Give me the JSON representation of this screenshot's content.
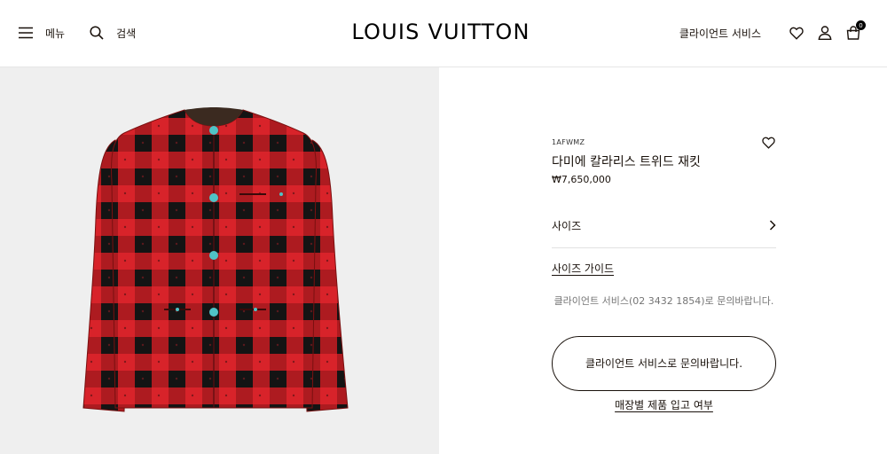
{
  "header": {
    "menu_label": "메뉴",
    "search_label": "검색",
    "logo_text": "LOUIS VUITTON",
    "client_service_label": "클라이언트 서비스",
    "cart_count": "0"
  },
  "product": {
    "sku": "1AFWMZ",
    "title": "다미에 칼라리스 트위드 재킷",
    "price": "₩7,650,000",
    "size_label": "사이즈",
    "size_guide_label": "사이즈 가이드",
    "cs_note": "클라이언트 서비스(02 3432 1854)로 문의바랍니다.",
    "cs_button_label": "클라이언트 서비스로 문의바랍니다.",
    "stock_link_label": "매장별 제품 입고 여부"
  },
  "colors": {
    "text": "#19110b",
    "muted": "#757575",
    "image_bg": "#efefef",
    "jacket_red": "#d8232a",
    "jacket_black": "#111111",
    "button_turquoise": "#4fc3c6"
  },
  "icons": [
    "hamburger-icon",
    "search-icon",
    "heart-icon",
    "user-icon",
    "bag-icon",
    "chevron-right-icon"
  ]
}
